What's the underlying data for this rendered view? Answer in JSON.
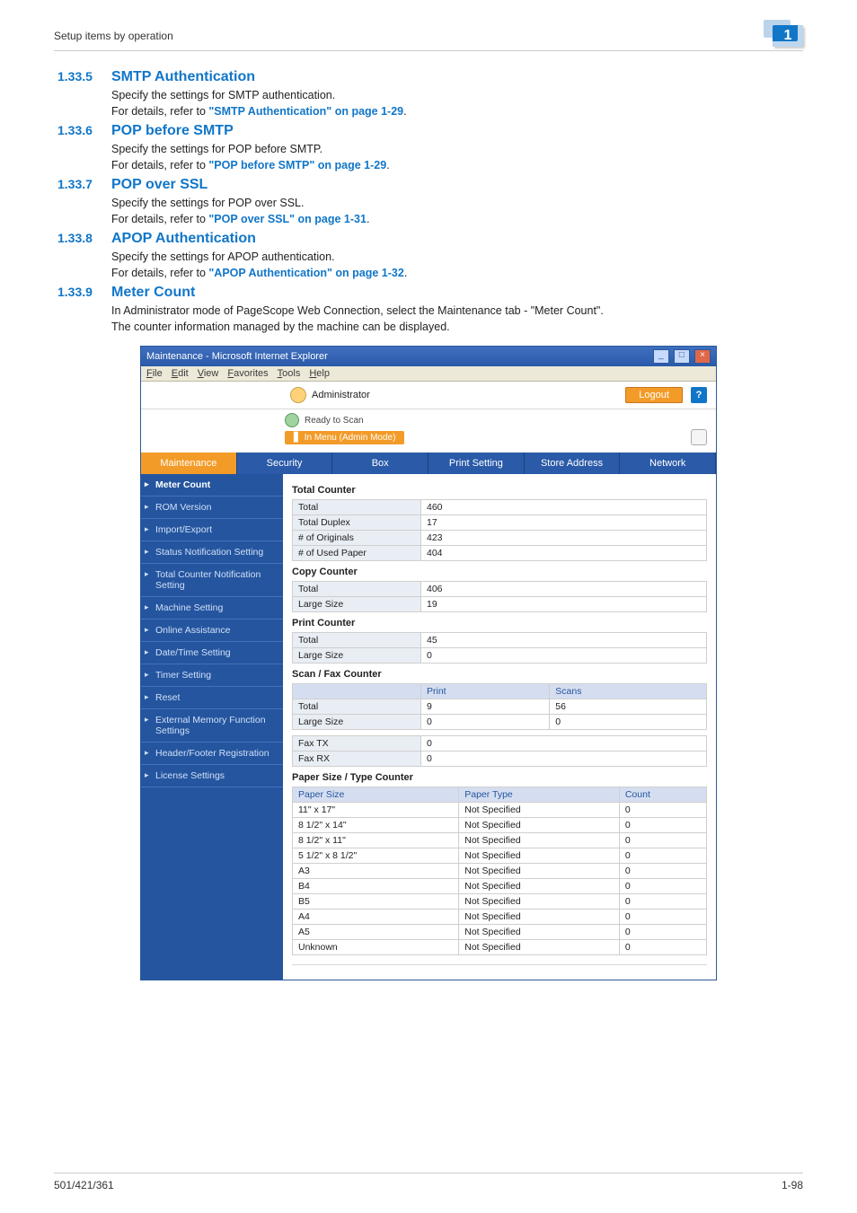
{
  "header": {
    "path": "Setup items by operation",
    "badge": "1"
  },
  "sections": [
    {
      "num": "1.33.5",
      "title": "SMTP Authentication",
      "line1": "Specify the settings for SMTP authentication.",
      "line2_prefix": "For details, refer to ",
      "link": "\"SMTP Authentication\" on page 1-29",
      "line2_suffix": "."
    },
    {
      "num": "1.33.6",
      "title": "POP before SMTP",
      "line1": "Specify the settings for POP before SMTP.",
      "line2_prefix": "For details, refer to ",
      "link": "\"POP before SMTP\" on page 1-29",
      "line2_suffix": "."
    },
    {
      "num": "1.33.7",
      "title": "POP over SSL",
      "line1": "Specify the settings for POP over SSL.",
      "line2_prefix": "For details, refer to ",
      "link": "\"POP over SSL\" on page 1-31",
      "line2_suffix": "."
    },
    {
      "num": "1.33.8",
      "title": "APOP Authentication",
      "line1": "Specify the settings for APOP authentication.",
      "line2_prefix": "For details, refer to ",
      "link": "\"APOP Authentication\" on page 1-32",
      "line2_suffix": "."
    },
    {
      "num": "1.33.9",
      "title": "Meter Count",
      "line1": "In Administrator mode of PageScope Web Connection, select the Maintenance tab - \"Meter Count\".",
      "line2_plain": "The counter information managed by the machine can be displayed."
    }
  ],
  "browser": {
    "title": "Maintenance - Microsoft Internet Explorer",
    "menus": [
      "File",
      "Edit",
      "View",
      "Favorites",
      "Tools",
      "Help"
    ],
    "admin_label": "Administrator",
    "logout": "Logout",
    "help": "?",
    "ready": "Ready to Scan",
    "mode": "In Menu (Admin Mode)",
    "tabs": [
      "Maintenance",
      "Security",
      "Box",
      "Print Setting",
      "Store Address",
      "Network"
    ],
    "active_tab": 0,
    "sidebar": [
      "Meter Count",
      "ROM Version",
      "Import/Export",
      "Status Notification Setting",
      "Total Counter Notification Setting",
      "Machine Setting",
      "Online Assistance",
      "Date/Time Setting",
      "Timer Setting",
      "Reset",
      "External Memory Function Settings",
      "Header/Footer Registration",
      "License Settings"
    ],
    "active_sidebar": 0,
    "total_counter_title": "Total Counter",
    "total_counter": [
      [
        "Total",
        "460"
      ],
      [
        "Total Duplex",
        "17"
      ],
      [
        "# of Originals",
        "423"
      ],
      [
        "# of Used Paper",
        "404"
      ]
    ],
    "copy_counter_title": "Copy Counter",
    "copy_counter": [
      [
        "Total",
        "406"
      ],
      [
        "Large Size",
        "19"
      ]
    ],
    "print_counter_title": "Print Counter",
    "print_counter": [
      [
        "Total",
        "45"
      ],
      [
        "Large Size",
        "0"
      ]
    ],
    "scanfax_title": "Scan / Fax Counter",
    "scanfax_head": [
      "",
      "Print",
      "Scans"
    ],
    "scanfax_rows": [
      [
        "Total",
        "9",
        "56"
      ],
      [
        "Large Size",
        "0",
        "0"
      ]
    ],
    "fax_rows": [
      [
        "Fax TX",
        "0"
      ],
      [
        "Fax RX",
        "0"
      ]
    ],
    "paper_title": "Paper Size / Type Counter",
    "paper_head": [
      "Paper Size",
      "Paper Type",
      "Count"
    ],
    "paper_rows": [
      [
        "11\" x 17\"",
        "Not Specified",
        "0"
      ],
      [
        "8 1/2\" x 14\"",
        "Not Specified",
        "0"
      ],
      [
        "8 1/2\" x 11\"",
        "Not Specified",
        "0"
      ],
      [
        "5 1/2\" x 8 1/2\"",
        "Not Specified",
        "0"
      ],
      [
        "A3",
        "Not Specified",
        "0"
      ],
      [
        "B4",
        "Not Specified",
        "0"
      ],
      [
        "B5",
        "Not Specified",
        "0"
      ],
      [
        "A4",
        "Not Specified",
        "0"
      ],
      [
        "A5",
        "Not Specified",
        "0"
      ],
      [
        "Unknown",
        "Not Specified",
        "0"
      ]
    ]
  },
  "footer": {
    "left": "501/421/361",
    "right": "1-98"
  }
}
